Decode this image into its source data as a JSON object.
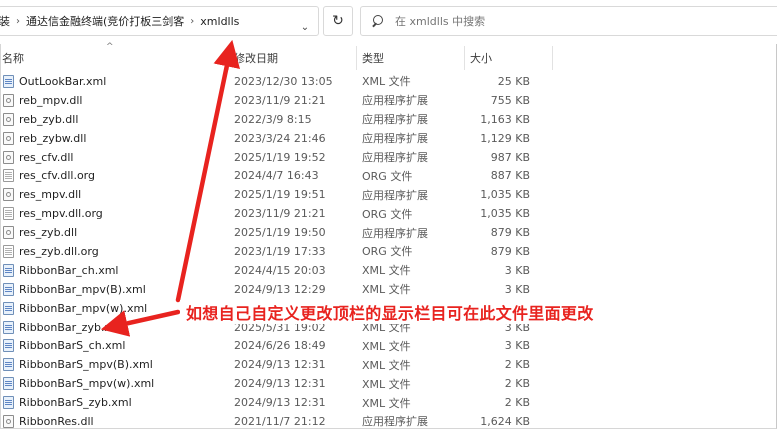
{
  "breadcrumb": {
    "items": [
      "装",
      "通达信金融终端(竞价打板三剑客",
      "xmldlls"
    ],
    "refresh_icon": "refresh-icon",
    "chevron_icon": "chevron-down-icon"
  },
  "search": {
    "placeholder": "在 xmldlls 中搜索",
    "icon": "search-icon"
  },
  "columns": {
    "name": "名称",
    "date": "修改日期",
    "type": "类型",
    "size": "大小"
  },
  "files": [
    {
      "name": "OutLookBar.xml",
      "date": "2023/12/30 13:05",
      "type": "XML 文件",
      "size": "25 KB",
      "icon": "xml"
    },
    {
      "name": "reb_mpv.dll",
      "date": "2023/11/9 21:21",
      "type": "应用程序扩展",
      "size": "755 KB",
      "icon": "dll"
    },
    {
      "name": "reb_zyb.dll",
      "date": "2022/3/9 8:15",
      "type": "应用程序扩展",
      "size": "1,163 KB",
      "icon": "dll"
    },
    {
      "name": "reb_zybw.dll",
      "date": "2023/3/24 21:46",
      "type": "应用程序扩展",
      "size": "1,129 KB",
      "icon": "dll"
    },
    {
      "name": "res_cfv.dll",
      "date": "2025/1/19 19:52",
      "type": "应用程序扩展",
      "size": "987 KB",
      "icon": "dll"
    },
    {
      "name": "res_cfv.dll.org",
      "date": "2024/4/7 16:43",
      "type": "ORG 文件",
      "size": "887 KB",
      "icon": "org"
    },
    {
      "name": "res_mpv.dll",
      "date": "2025/1/19 19:51",
      "type": "应用程序扩展",
      "size": "1,035 KB",
      "icon": "dll"
    },
    {
      "name": "res_mpv.dll.org",
      "date": "2023/11/9 21:21",
      "type": "ORG 文件",
      "size": "1,035 KB",
      "icon": "org"
    },
    {
      "name": "res_zyb.dll",
      "date": "2025/1/19 19:50",
      "type": "应用程序扩展",
      "size": "879 KB",
      "icon": "dll"
    },
    {
      "name": "res_zyb.dll.org",
      "date": "2023/1/19 17:33",
      "type": "ORG 文件",
      "size": "879 KB",
      "icon": "org"
    },
    {
      "name": "RibbonBar_ch.xml",
      "date": "2024/4/15 20:03",
      "type": "XML 文件",
      "size": "3 KB",
      "icon": "xml"
    },
    {
      "name": "RibbonBar_mpv(B).xml",
      "date": "2024/9/13 12:29",
      "type": "XML 文件",
      "size": "3 KB",
      "icon": "xml"
    },
    {
      "name": "RibbonBar_mpv(w).xml",
      "date": "",
      "type": "",
      "size": "",
      "icon": "xml"
    },
    {
      "name": "RibbonBar_zyb.xml",
      "date": "2025/5/31 19:02",
      "type": "XML 文件",
      "size": "3 KB",
      "icon": "xml"
    },
    {
      "name": "RibbonBarS_ch.xml",
      "date": "2024/6/26 18:49",
      "type": "XML 文件",
      "size": "3 KB",
      "icon": "xml"
    },
    {
      "name": "RibbonBarS_mpv(B).xml",
      "date": "2024/9/13 12:31",
      "type": "XML 文件",
      "size": "2 KB",
      "icon": "xml"
    },
    {
      "name": "RibbonBarS_mpv(w).xml",
      "date": "2024/9/13 12:31",
      "type": "XML 文件",
      "size": "2 KB",
      "icon": "xml"
    },
    {
      "name": "RibbonBarS_zyb.xml",
      "date": "2024/9/13 12:31",
      "type": "XML 文件",
      "size": "2 KB",
      "icon": "xml"
    },
    {
      "name": "RibbonRes.dll",
      "date": "2021/11/7 21:12",
      "type": "应用程序扩展",
      "size": "1,624 KB",
      "icon": "dll"
    }
  ],
  "annotation": {
    "text": "如想自己自定义更改顶栏的显示栏目可在此文件里面更改",
    "color": "#e8231f"
  }
}
